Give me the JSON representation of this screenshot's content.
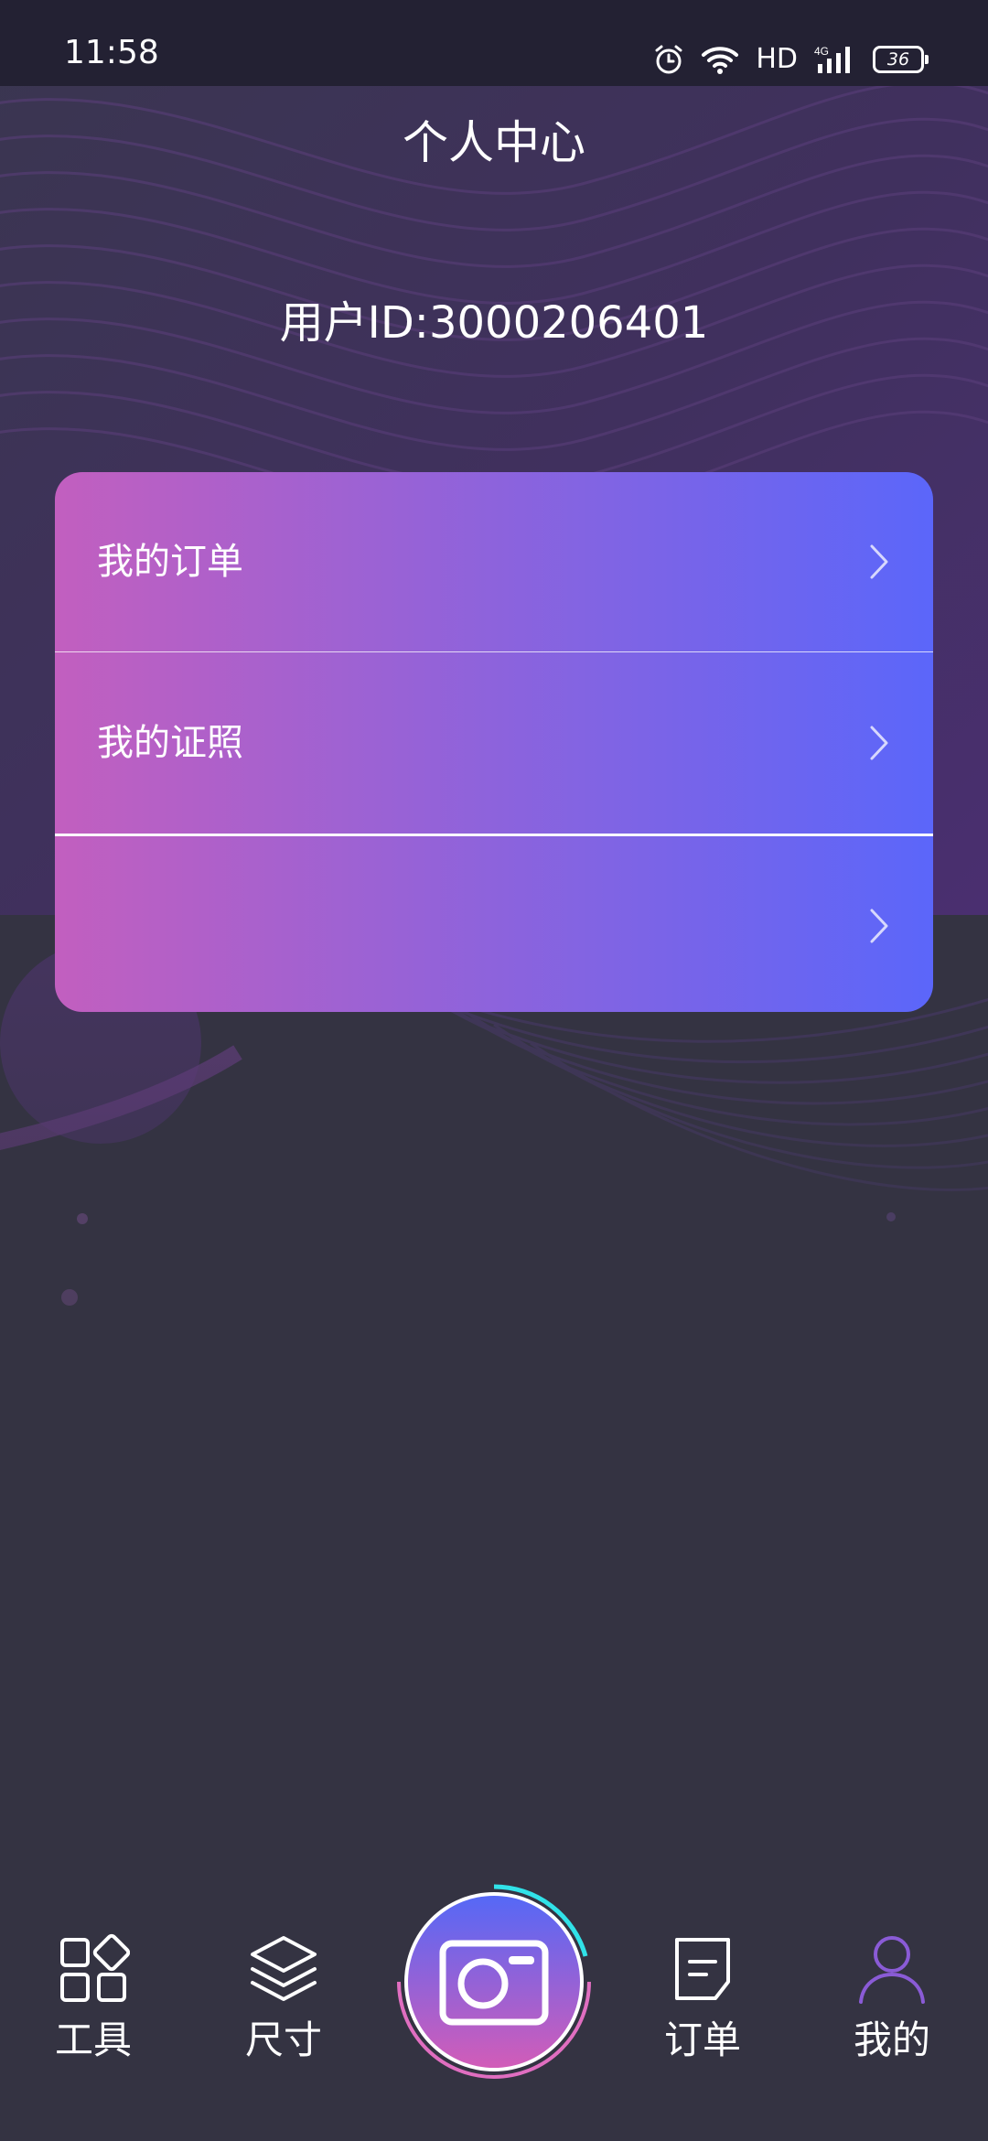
{
  "status_bar": {
    "time": "11:58",
    "network": "HD",
    "battery": "36",
    "icons": [
      "alarm-icon",
      "wifi-icon",
      "signal-4g-icon",
      "battery-icon"
    ]
  },
  "header": {
    "title": "个人中心",
    "user_id": "用户ID:3000206401"
  },
  "menu": {
    "items": [
      {
        "label": "我的订单"
      },
      {
        "label": "我的证照"
      },
      {
        "label": ""
      }
    ]
  },
  "bottom_nav": {
    "items": [
      {
        "label": "工具",
        "icon": "tools-grid-icon"
      },
      {
        "label": "尺寸",
        "icon": "layers-icon"
      },
      {
        "label": "订单",
        "icon": "order-note-icon"
      },
      {
        "label": "我的",
        "icon": "user-icon",
        "active": true
      }
    ],
    "center": {
      "icon": "camera-icon"
    }
  },
  "colors": {
    "background": "#343342",
    "status_bar": "#232133",
    "card_gradient_start": "#c25fbf",
    "card_gradient_end": "#5b66fa",
    "active_nav": "#8a5bd6"
  }
}
